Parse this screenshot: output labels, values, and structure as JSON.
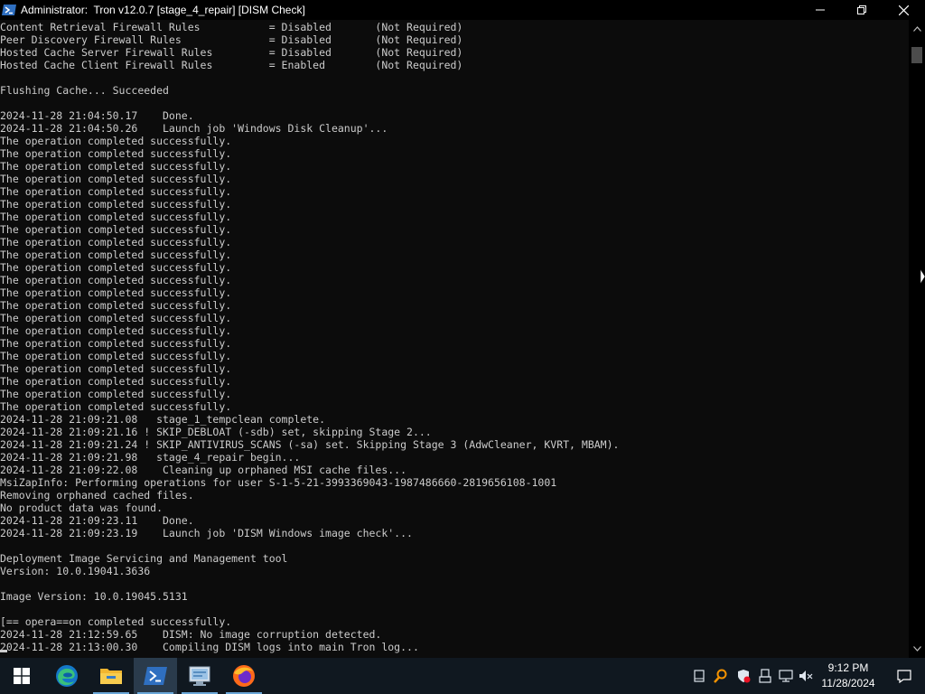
{
  "window": {
    "title": "Administrator:  Tron v12.0.7 [stage_4_repair] [DISM Check]"
  },
  "console": {
    "lines": [
      "Content Retrieval Firewall Rules           = Disabled       (Not Required)",
      "Peer Discovery Firewall Rules              = Disabled       (Not Required)",
      "Hosted Cache Server Firewall Rules         = Disabled       (Not Required)",
      "Hosted Cache Client Firewall Rules         = Enabled        (Not Required)",
      "",
      "Flushing Cache... Succeeded",
      "",
      "2024-11-28 21:04:50.17    Done.",
      "2024-11-28 21:04:50.26    Launch job 'Windows Disk Cleanup'...",
      "The operation completed successfully.",
      "The operation completed successfully.",
      "The operation completed successfully.",
      "The operation completed successfully.",
      "The operation completed successfully.",
      "The operation completed successfully.",
      "The operation completed successfully.",
      "The operation completed successfully.",
      "The operation completed successfully.",
      "The operation completed successfully.",
      "The operation completed successfully.",
      "The operation completed successfully.",
      "The operation completed successfully.",
      "The operation completed successfully.",
      "The operation completed successfully.",
      "The operation completed successfully.",
      "The operation completed successfully.",
      "The operation completed successfully.",
      "The operation completed successfully.",
      "The operation completed successfully.",
      "The operation completed successfully.",
      "The operation completed successfully.",
      "2024-11-28 21:09:21.08   stage_1_tempclean complete.",
      "2024-11-28 21:09:21.16 ! SKIP_DEBLOAT (-sdb) set, skipping Stage 2...",
      "2024-11-28 21:09:21.24 ! SKIP_ANTIVIRUS_SCANS (-sa) set. Skipping Stage 3 (AdwCleaner, KVRT, MBAM).",
      "2024-11-28 21:09:21.98   stage_4_repair begin...",
      "2024-11-28 21:09:22.08    Cleaning up orphaned MSI cache files...",
      "MsiZapInfo: Performing operations for user S-1-5-21-3993369043-1987486660-2819656108-1001",
      "Removing orphaned cached files.",
      "No product data was found.",
      "2024-11-28 21:09:23.11    Done.",
      "2024-11-28 21:09:23.19    Launch job 'DISM Windows image check'...",
      "",
      "Deployment Image Servicing and Management tool",
      "Version: 10.0.19041.3636",
      "",
      "Image Version: 10.0.19045.5131",
      "",
      "[== opera==on completed successfully.",
      "2024-11-28 21:12:59.65    DISM: No image corruption detected.",
      "2024-11-28 21:13:00.30    Compiling DISM logs into main Tron log..."
    ]
  },
  "icons": {
    "title": "powershell-icon",
    "minimize": "minimize-icon",
    "maximize": "restore-icon",
    "close": "close-icon",
    "start": "windows-start-icon",
    "edge": "edge-icon",
    "explorer": "file-explorer-icon",
    "powershell": "powershell-icon",
    "control": "control-panel-icon",
    "firefox": "firefox-icon",
    "notifications": "notification-center-icon"
  },
  "taskbar": {
    "clock_time": "9:12 PM",
    "clock_date": "11/28/2024"
  },
  "colors": {
    "console_bg": "#0c0c0c",
    "console_text": "#cccccc",
    "taskbar_bg": "#101820",
    "accent": "#6aa7d8"
  }
}
